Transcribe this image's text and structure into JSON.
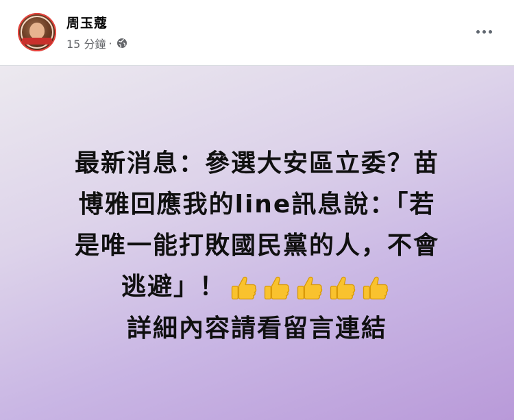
{
  "post": {
    "author": "周玉蔻",
    "time": "15 分鐘",
    "separator": "·",
    "privacy_icon": "globe-icon",
    "more_icon": "more-horizontal-icon",
    "lines": [
      "最新消息：參選大安區立委？苗",
      "博雅回應我的line訊息說：「若",
      "是唯一能打敗國民黨的人，不會",
      "逃避」！",
      "詳細內容請看留言連結"
    ],
    "emoji": "👍👍👍👍👍",
    "emoji_icon": "thumbs-up-emoji",
    "emoji_count": 5,
    "background_colors": [
      "#ece9ef",
      "#ddd3ea",
      "#c9b6e4",
      "#b99ad9"
    ]
  }
}
